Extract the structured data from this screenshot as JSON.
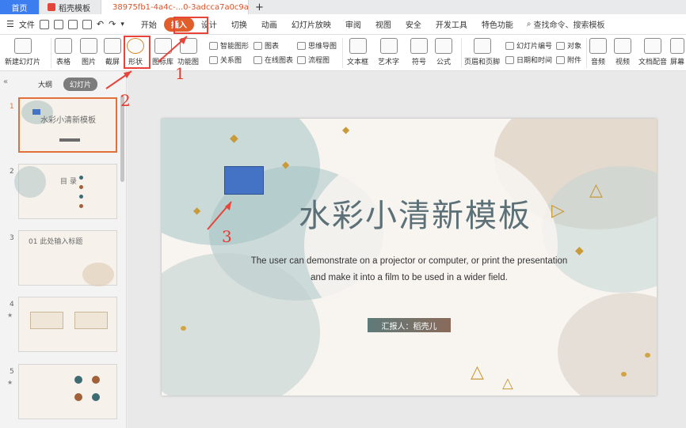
{
  "tabs": [
    {
      "label": "首页"
    },
    {
      "label": "稻壳模板"
    },
    {
      "label": "38975fb1-4a4c-...0-3adcca7a0c9a"
    },
    {
      "label": "+"
    }
  ],
  "menubar": {
    "file_label": "文件",
    "items": [
      "开始",
      "插入",
      "设计",
      "切换",
      "动画",
      "幻灯片放映",
      "审阅",
      "视图",
      "安全",
      "开发工具",
      "特色功能"
    ],
    "search_placeholder": "查找命令、搜索模板"
  },
  "ribbon": {
    "new_slide": "新建幻灯片",
    "table": "表格",
    "picture": "图片",
    "screenshot": "截屏",
    "shape": "形状",
    "icon_lib": "图标库",
    "func_chart": "功能图",
    "smart_art": "智能图形",
    "chart": "图表",
    "relation": "关系图",
    "online_chart": "在线图表",
    "mindmap": "思维导图",
    "flowchart": "流程图",
    "textbox": "文本框",
    "wordart": "艺术字",
    "symbol": "符号",
    "formula": "公式",
    "header_footer": "页眉和页脚",
    "slide_number": "幻灯片编号",
    "datetime": "日期和时间",
    "object": "对象",
    "attachment": "附件",
    "audio": "音频",
    "video": "视频",
    "narration": "文档配音",
    "screen": "屏幕"
  },
  "leftpane": {
    "tab_outline": "大纲",
    "tab_slides": "幻灯片",
    "thumbnails": [
      {
        "num": "1",
        "text": "水彩小清新模板"
      },
      {
        "num": "2",
        "text": "目 录"
      },
      {
        "num": "3",
        "text": "01 此处输入标题"
      },
      {
        "num": "4",
        "text": ""
      },
      {
        "num": "5",
        "text": ""
      }
    ]
  },
  "slide": {
    "title": "水彩小清新模板",
    "subtitle_line1": "The user can demonstrate on a projector or computer, or print the presentation",
    "subtitle_line2": "and make it into a film to be used in a wider field.",
    "reporter": "汇报人：稻壳儿"
  },
  "annotations": {
    "step1": "1",
    "step2": "2",
    "step3": "3"
  },
  "colors": {
    "accent_insert": "#e15e2a",
    "home_tab": "#3c7ef0",
    "annotation_red": "#e8443a",
    "shape_fill": "#4472c4"
  }
}
